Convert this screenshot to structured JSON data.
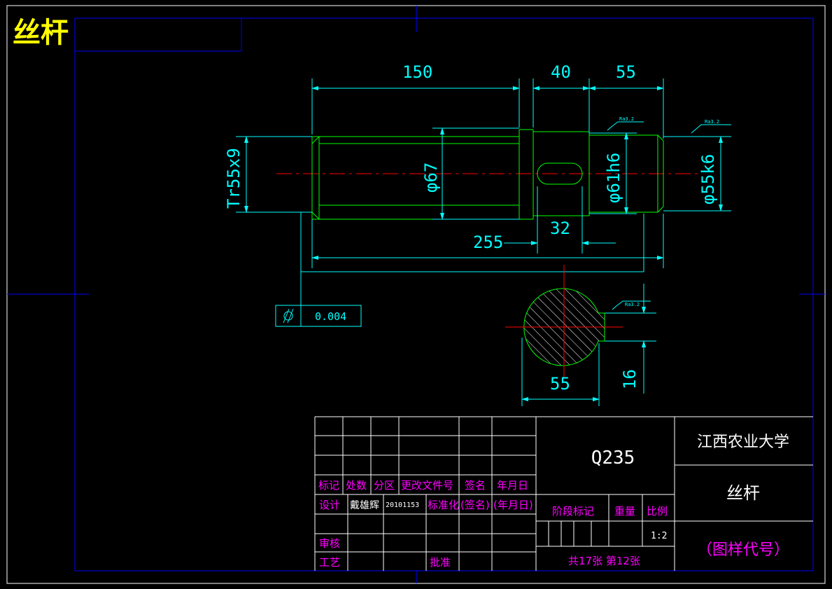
{
  "drawing": {
    "name": "丝杆",
    "dimensions": {
      "len_150": "150",
      "len_40": "40",
      "len_55_top": "55",
      "len_255": "255",
      "len_32": "32",
      "dia_tr": "Tr55x9",
      "dia_67": "φ67",
      "dia_61": "φ61h6",
      "dia_55": "φ55k6",
      "sec_width": "55",
      "sec_depth": "16"
    },
    "roughness": [
      "Ra3.2",
      "Ra3.2",
      "Ra3.2"
    ],
    "tolerance": {
      "symbol": "cylindricity-icon",
      "value": "0.004"
    }
  },
  "title_block": {
    "material": "Q235",
    "school": "江西农业大学",
    "part_name": "丝杆",
    "drawing_code": "（图样代号）",
    "headers": [
      "标记",
      "处数",
      "分区",
      "更改文件号",
      "签名",
      "年月日"
    ],
    "design_row": [
      "设计",
      "戴雄辉",
      "20101153",
      "标准化",
      "(签名)",
      "(年月日)"
    ],
    "stage_label": "阶段标记",
    "weight_label": "重量",
    "scale_label": "比例",
    "scale_value": "1:2",
    "review_label": "审核",
    "process_label": "工艺",
    "approve_label": "批准",
    "sheets": "共17张  第12张"
  },
  "colors": {
    "frame": "#0000ff",
    "outline": "#00ff00",
    "dimension": "#00ffff",
    "centerline": "#ff0000",
    "title": "#ffff00",
    "label": "#ff00ff",
    "text": "#ffffff"
  }
}
